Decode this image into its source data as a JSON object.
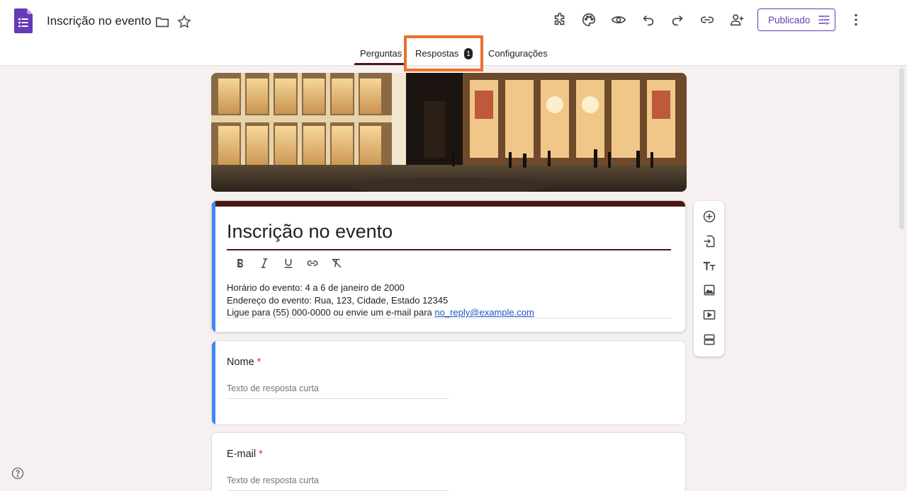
{
  "header": {
    "doc_title": "Inscrição no evento",
    "publish_label": "Publicado",
    "icons": [
      "folder-icon",
      "star-icon",
      "addon-icon",
      "palette-icon",
      "preview-icon",
      "undo-icon",
      "redo-icon",
      "link-icon",
      "add-collaborator-icon",
      "more-icon"
    ]
  },
  "tabs": [
    {
      "label": "Perguntas"
    },
    {
      "label": "Respostas",
      "badge": "1"
    },
    {
      "label": "Configurações"
    }
  ],
  "form": {
    "title": "Inscrição no evento",
    "description": {
      "line1": "Horário do evento: 4 a 6 de janeiro de 2000",
      "line2": "Endereço do evento: Rua, 123, Cidade, Estado 12345",
      "line3_prefix": "Ligue para (55) 000-0000 ou envie um e-mail para ",
      "email": "no_reply@example.com"
    }
  },
  "questions": [
    {
      "label": "Nome",
      "required_mark": "*",
      "placeholder": "Texto de resposta curta"
    },
    {
      "label": "E-mail",
      "required_mark": "*",
      "placeholder": "Texto de resposta curta"
    }
  ],
  "colors": {
    "accent": "#673ab7",
    "theme": "#4a1a12",
    "highlight": "#ec6f2d",
    "focus": "#4285f4"
  }
}
